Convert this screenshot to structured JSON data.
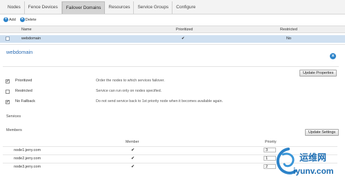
{
  "nav": {
    "tabs": [
      {
        "label": "Nodes",
        "active": false
      },
      {
        "label": "Fence Devices",
        "active": false
      },
      {
        "label": "Failover Domains",
        "active": true
      },
      {
        "label": "Resources",
        "active": false
      },
      {
        "label": "Service Groups",
        "active": false
      },
      {
        "label": "Configure",
        "active": false
      }
    ]
  },
  "toolbar": {
    "add_label": "Add",
    "delete_label": "Delete",
    "add_icon": "plus-icon",
    "delete_icon": "x-icon"
  },
  "domains_table": {
    "columns": [
      "Name",
      "Prioritized",
      "Restricted"
    ],
    "rows": [
      {
        "name": "webdomain",
        "prioritized": "✔",
        "restricted": "No"
      }
    ]
  },
  "detail": {
    "title": "webdomain",
    "update_properties_label": "Update Properties",
    "options": [
      {
        "label": "Prioritized",
        "checked": true,
        "description": "Order the nodes to which services failover."
      },
      {
        "label": "Restricted",
        "checked": false,
        "description": "Service can run only on nodes specified."
      },
      {
        "label": "No Failback",
        "checked": true,
        "description": "Do not send service back to 1st priority node when it becomes available again."
      }
    ],
    "services_label": "Services",
    "members_label": "Members",
    "update_settings_label": "Update Settings",
    "members_columns": [
      "Member",
      "Priority"
    ],
    "members": [
      {
        "name": "node1.jerry.com",
        "member": "✔",
        "priority": "3"
      },
      {
        "name": "node2.jerry.com",
        "member": "✔",
        "priority": "1"
      },
      {
        "name": "node3.jerry.com",
        "member": "✔",
        "priority": "2"
      }
    ]
  },
  "watermark": {
    "brand": "运维网",
    "url": "iyunv.com"
  },
  "colors": {
    "accent": "#2c83c9",
    "selected_row": "#cfe0f1",
    "title": "#2f6fb5"
  }
}
